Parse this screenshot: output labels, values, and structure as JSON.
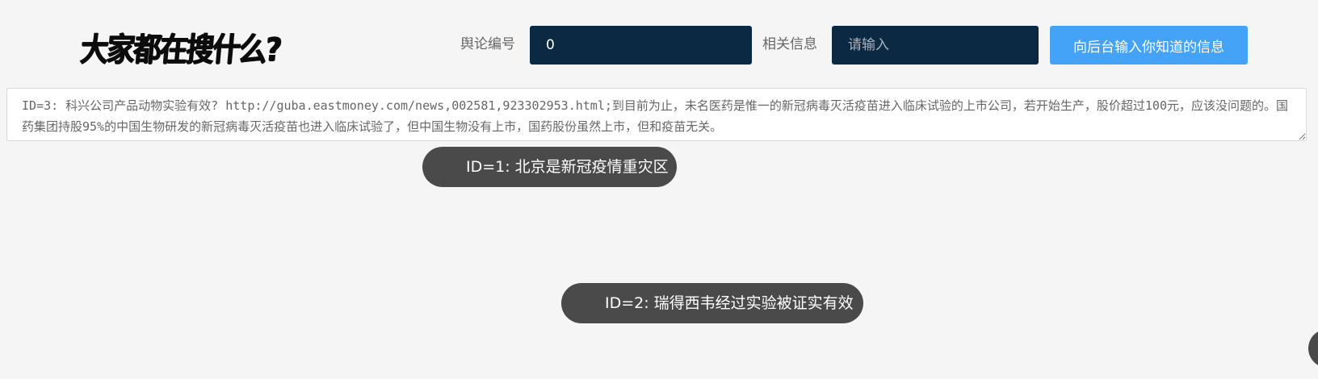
{
  "header": {
    "logo_text": "大家都在搜什么?"
  },
  "form": {
    "id_label": "舆论编号",
    "id_value": "0",
    "info_label": "相关信息",
    "info_placeholder": "请输入",
    "submit_label": "向后台输入你知道的信息"
  },
  "detail": {
    "text": "ID=3: 科兴公司产品动物实验有效? http://guba.eastmoney.com/news,002581,923302953.html;到目前为止，未名医药是惟一的新冠病毒灭活疫苗进入临床试验的上市公司，若开始生产，股价超过100元，应该没问题的。国药集团持股95%的中国生物研发的新冠病毒灭活疫苗也进入临床试验了，但中国生物没有上市，国药股份虽然上市，但和疫苗无关。"
  },
  "bubbles": [
    {
      "text": "ID=1: 北京是新冠疫情重灾区"
    },
    {
      "text": "ID=2: 瑞得西韦经过实验被证实有效"
    }
  ]
}
